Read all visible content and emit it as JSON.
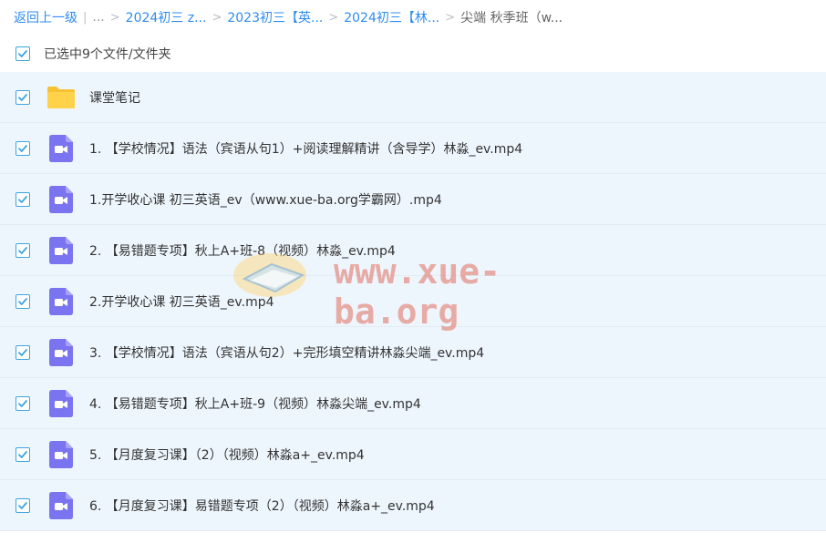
{
  "breadcrumb": {
    "back_label": "返回上一级",
    "divider": "|",
    "ellipsis": "...",
    "items": [
      "2024初三 z...",
      "2023初三【英...",
      "2024初三【林...",
      "尖端 秋季班（w..."
    ],
    "sep": ">"
  },
  "selection": {
    "summary": "已选中9个文件/文件夹",
    "checked": true
  },
  "files": [
    {
      "name": "课堂笔记",
      "type": "folder",
      "checked": true
    },
    {
      "name": "1. 【学校情况】语法（宾语从句1）+阅读理解精讲（含导学）林淼_ev.mp4",
      "type": "video",
      "checked": true
    },
    {
      "name": "1.开学收心课 初三英语_ev（www.xue-ba.org学霸网）.mp4",
      "type": "video",
      "checked": true
    },
    {
      "name": "2. 【易错题专项】秋上A+班-8（视频）林淼_ev.mp4",
      "type": "video",
      "checked": true
    },
    {
      "name": "2.开学收心课 初三英语_ev.mp4",
      "type": "video",
      "checked": true
    },
    {
      "name": "3. 【学校情况】语法（宾语从句2）+完形填空精讲林淼尖端_ev.mp4",
      "type": "video",
      "checked": true
    },
    {
      "name": "4. 【易错题专项】秋上A+班-9（视频）林淼尖端_ev.mp4",
      "type": "video",
      "checked": true
    },
    {
      "name": "5. 【月度复习课】（2）（视频）林淼a+_ev.mp4",
      "type": "video",
      "checked": true
    },
    {
      "name": "6. 【月度复习课】易错题专项（2）（视频）林淼a+_ev.mp4",
      "type": "video",
      "checked": true
    }
  ],
  "watermark": {
    "text": "www.xue-ba.org"
  },
  "colors": {
    "link": "#2d8cf0",
    "row_bg": "#eef6fd",
    "checkbox": "#3ca4e0",
    "folder": "#ffd24a",
    "video": "#7b74f0"
  },
  "icons": {
    "folder": "folder-icon",
    "video": "video-file-icon",
    "check": "check-icon"
  }
}
